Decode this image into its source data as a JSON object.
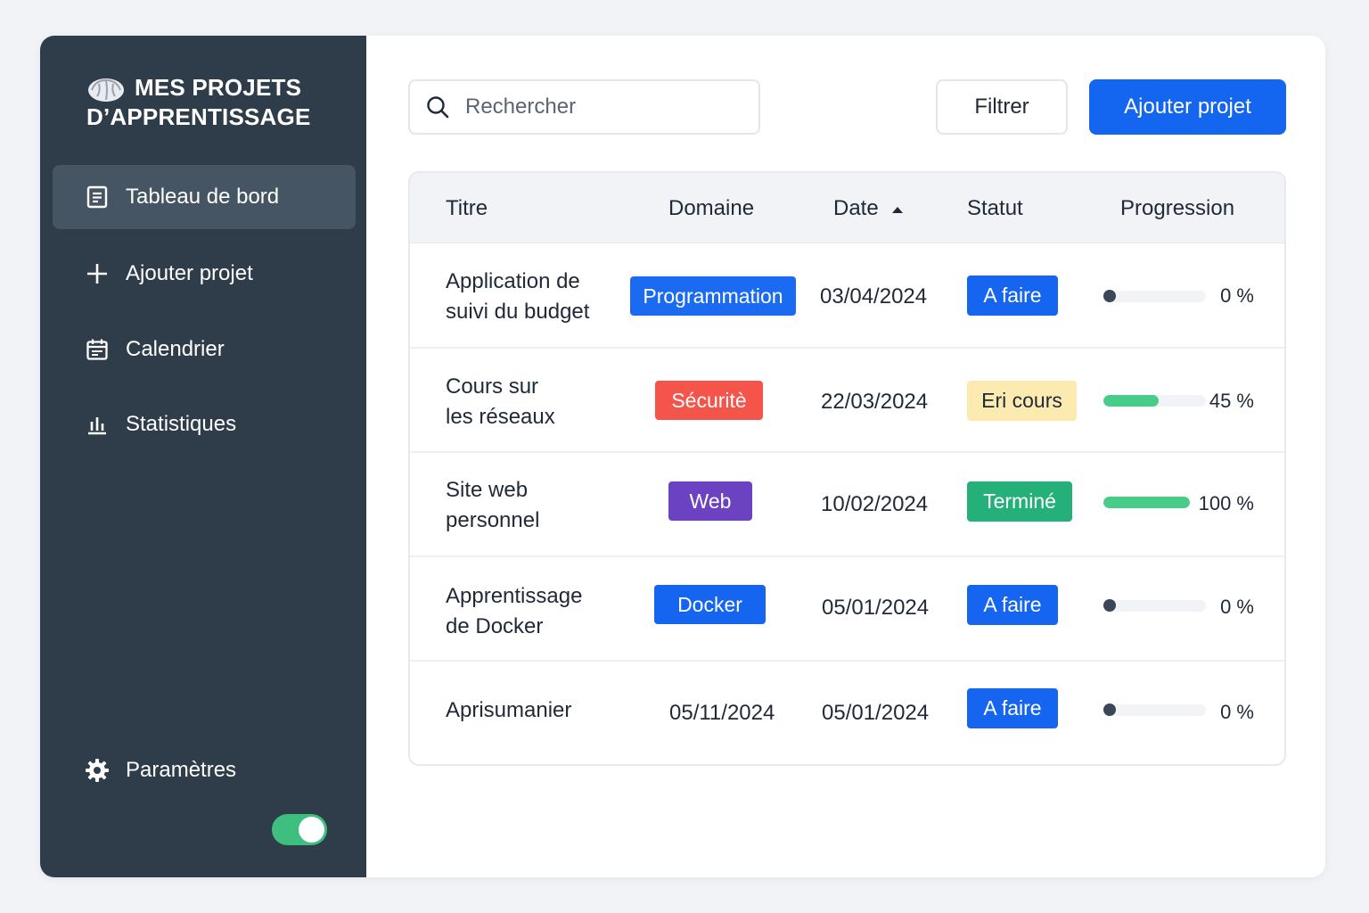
{
  "brand": {
    "title": "MES PROJETS D’APPRENTISSAGE",
    "icon": "brain-icon"
  },
  "sidebar": {
    "items": [
      {
        "label": "Tableau de bord",
        "icon": "document-icon",
        "active": true
      },
      {
        "label": "Ajouter projet",
        "icon": "plus-icon"
      },
      {
        "label": "Calendrier",
        "icon": "calendar-icon"
      },
      {
        "label": "Statistiques",
        "icon": "bar-chart-icon"
      }
    ],
    "settings": {
      "label": "Paramètres",
      "icon": "gear-icon"
    },
    "toggle_on": true
  },
  "toolbar": {
    "search_placeholder": "Rechercher",
    "filter_label": "Filtrer",
    "add_label": "Ajouter projet"
  },
  "table": {
    "headers": [
      "Titre",
      "Domaine",
      "Date",
      "Statut",
      "Progression"
    ],
    "sort_icon": "sort-up-icon",
    "rows": [
      {
        "title_line1": "Application de",
        "title_line2": "suivi du budget",
        "domain": "Programmation",
        "domain_color": "#1b6bf2",
        "date": "03/04/2024",
        "status": "A faire",
        "status_color": "#1665f0",
        "status_text_color": "#ffffff",
        "progress": 0,
        "progress_label": "0 %"
      },
      {
        "title_line1": "Cours sur",
        "title_line2": "les réseaux",
        "domain": "Sécuritè",
        "domain_color": "#f4544a",
        "date": "22/03/2024",
        "status": "Eri cours",
        "status_color": "#fcebb0",
        "status_text_color": "#1f2937",
        "progress": 0.45,
        "progress_label": "45 %"
      },
      {
        "title_line1": "Site web",
        "title_line2": "personnel",
        "domain": "Web",
        "domain_color": "#6a42c2",
        "date": "10/02/2024",
        "status": "Terminé",
        "status_color": "#25b07a",
        "status_text_color": "#ffffff",
        "progress": 1.0,
        "progress_label": "100 %"
      },
      {
        "title_line1": "Apprentissage",
        "title_line2": "de Docker",
        "domain": "Docker",
        "domain_color": "#1665f0",
        "date": "05/01/2024",
        "status": "A faire",
        "status_color": "#1665f0",
        "status_text_color": "#ffffff",
        "progress": 0,
        "progress_label": "0 %"
      },
      {
        "title_line1": "Aprisumanier",
        "title_line2": "",
        "domain": "05/11/2024",
        "domain_color": "",
        "date": "05/01/2024",
        "status": "A faire",
        "status_color": "#1665f0",
        "status_text_color": "#ffffff",
        "progress": 0,
        "progress_label": "0 %"
      }
    ]
  }
}
